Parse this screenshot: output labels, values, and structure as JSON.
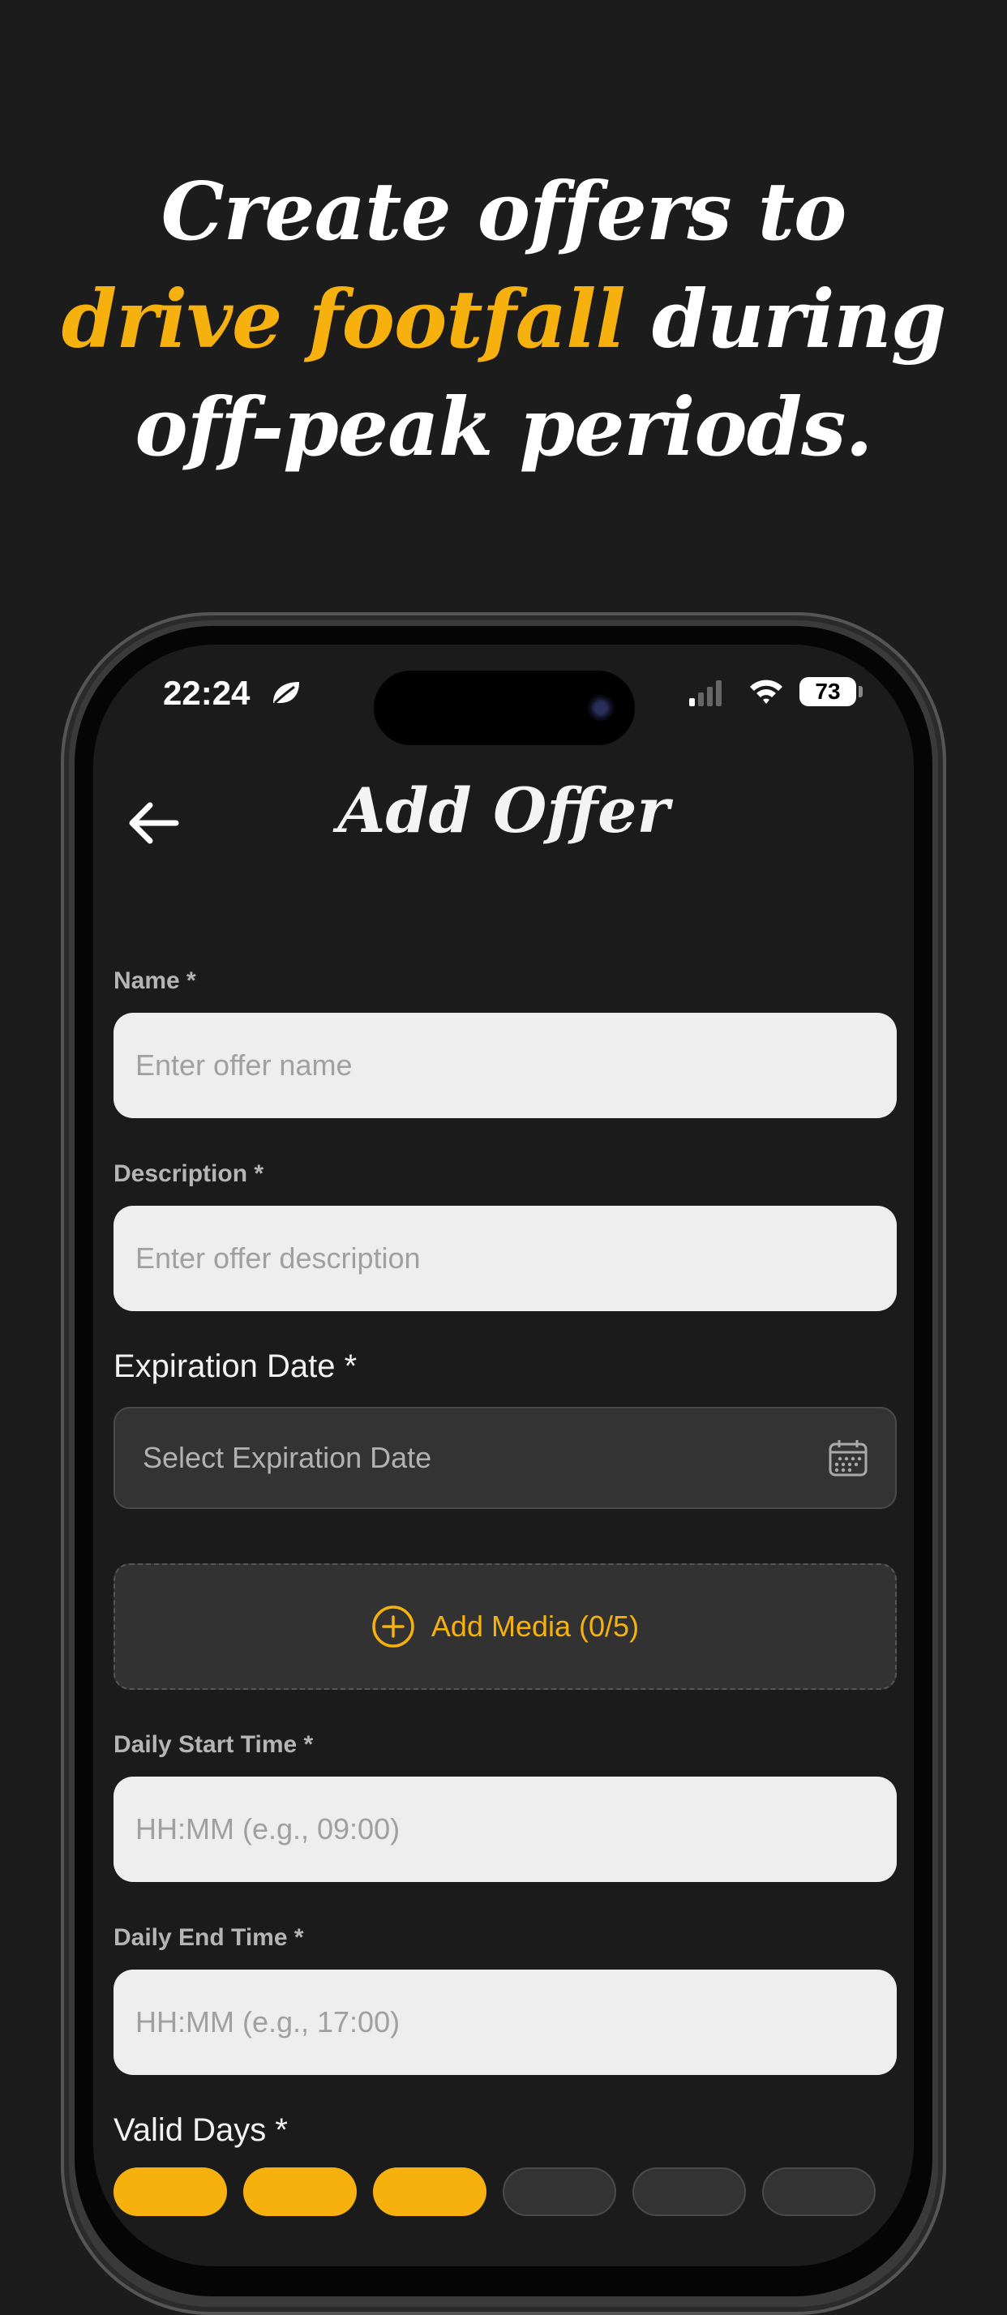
{
  "headline": {
    "line1": "Create offers to",
    "line2_highlight": "drive footfall",
    "line2_rest": " during",
    "line3": "off-peak periods."
  },
  "colors": {
    "accent": "#f6b10e",
    "background": "#1c1c1c",
    "screen_background": "#1b1b1b",
    "input_light": "#eeeeee",
    "input_dark": "#333333"
  },
  "status_bar": {
    "time": "22:24",
    "battery": "73",
    "icons": [
      "leaf-icon",
      "cellular-signal-icon",
      "wifi-icon",
      "battery-icon"
    ]
  },
  "nav": {
    "title": "Add Offer",
    "back_icon": "arrow-left-icon"
  },
  "form": {
    "name": {
      "label": "Name *",
      "placeholder": "Enter offer name"
    },
    "description": {
      "label": "Description *",
      "placeholder": "Enter offer description"
    },
    "expiration": {
      "label": "Expiration Date *",
      "placeholder": "Select Expiration Date",
      "icon": "calendar-icon"
    },
    "media": {
      "label": "Add Media (0/5)",
      "icon": "plus-circle-icon"
    },
    "start_time": {
      "label": "Daily Start Time *",
      "placeholder": "HH:MM (e.g., 09:00)"
    },
    "end_time": {
      "label": "Daily End Time *",
      "placeholder": "HH:MM (e.g., 17:00)"
    },
    "valid_days": {
      "label": "Valid Days *"
    }
  }
}
